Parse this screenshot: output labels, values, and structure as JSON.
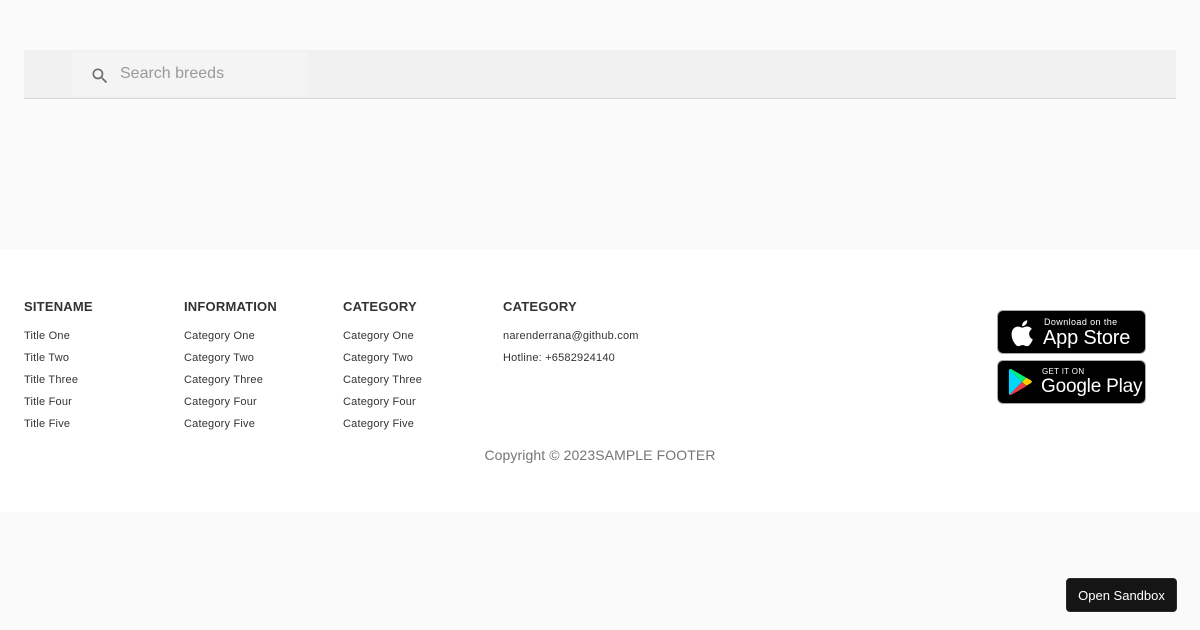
{
  "search": {
    "placeholder": "Search breeds",
    "value": ""
  },
  "footer": {
    "columns": [
      {
        "heading": "SITENAME",
        "items": [
          "Title One",
          "Title Two",
          "Title Three",
          "Title Four",
          "Title Five"
        ]
      },
      {
        "heading": "INFORMATION",
        "items": [
          "Category One",
          "Category Two",
          "Category Three",
          "Category Four",
          "Category Five"
        ]
      },
      {
        "heading": "CATEGORY",
        "items": [
          "Category One",
          "Category Two",
          "Category Three",
          "Category Four",
          "Category Five"
        ]
      },
      {
        "heading": "CATEGORY",
        "items": [
          "narenderrana@github.com",
          "Hotline: +6582924140"
        ]
      }
    ],
    "app_store": {
      "small": "Download on the",
      "big": "App Store"
    },
    "google_play": {
      "small": "GET IT ON",
      "big": "Google Play"
    },
    "copyright": "Copyright © 2023SAMPLE FOOTER"
  },
  "sandbox": {
    "label": "Open Sandbox"
  },
  "colors": {
    "page_background": "#fafafa",
    "footer_background": "#ffffff",
    "search_bar_background": "#f1f1f1",
    "badge_background": "#000000",
    "sandbox_button": "#151515"
  }
}
